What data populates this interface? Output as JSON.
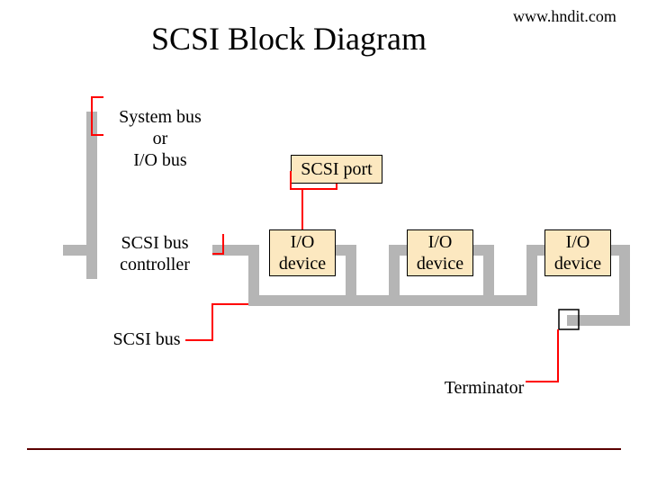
{
  "title": "SCSI Block Diagram",
  "url": "www.hndit.com",
  "labels": {
    "system_bus": "System bus\nor\nI/O bus",
    "scsi_port": "SCSI port",
    "scsi_bus_controller": "SCSI bus\ncontroller",
    "io_device_1": "I/O\ndevice",
    "io_device_2": "I/O\ndevice",
    "io_device_3": "I/O\ndevice",
    "scsi_bus": "SCSI bus",
    "terminator": "Terminator"
  },
  "colors": {
    "bus_gray": "#b5b5b5",
    "pointer_red": "#ff0000",
    "box_cream": "#fce8c0",
    "footer_rule": "#5a0000"
  }
}
